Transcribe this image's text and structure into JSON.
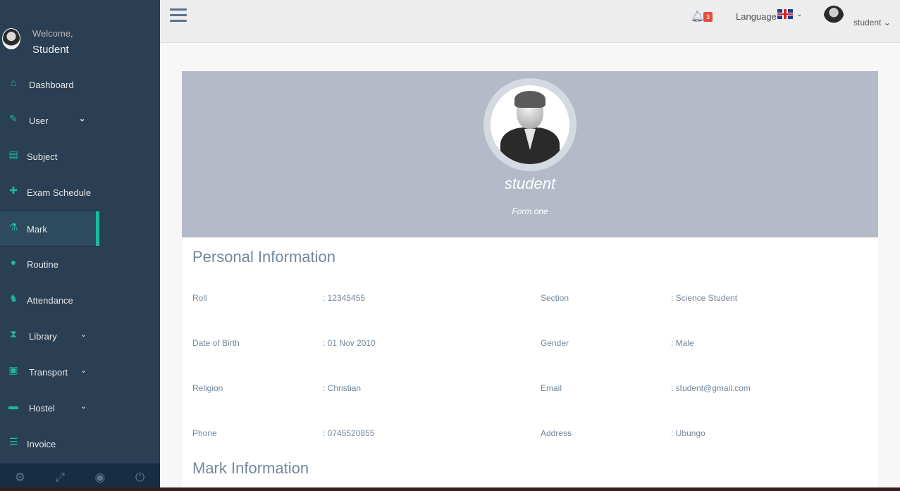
{
  "sidebar": {
    "welcome": "Welcome,",
    "username": "Student",
    "items": [
      {
        "label": "Dashboard",
        "icon": "home-icon",
        "glyph": "⌂",
        "chevron": ""
      },
      {
        "label": "User",
        "icon": "edit-icon",
        "glyph": "✎",
        "chevron": "⌄"
      },
      {
        "label": "Subject",
        "icon": "book-icon",
        "glyph": "▤",
        "chevron": ""
      },
      {
        "label": "Exam Schedule",
        "icon": "puzzle-icon",
        "glyph": "✚",
        "chevron": ""
      },
      {
        "label": "Mark",
        "icon": "flask-icon",
        "glyph": "⚗",
        "chevron": ""
      },
      {
        "label": "Routine",
        "icon": "check-circle-icon",
        "glyph": "●",
        "chevron": ""
      },
      {
        "label": "Attendance",
        "icon": "sitemap-icon",
        "glyph": "♞",
        "chevron": ""
      },
      {
        "label": "Library",
        "icon": "hourglass-icon",
        "glyph": "⧗",
        "chevron": "⌄"
      },
      {
        "label": "Transport",
        "icon": "bus-icon",
        "glyph": "▣",
        "chevron": "⌄"
      },
      {
        "label": "Hostel",
        "icon": "bed-icon",
        "glyph": "▬",
        "chevron": "⌄"
      },
      {
        "label": "Invoice",
        "icon": "list-icon",
        "glyph": "☰",
        "chevron": ""
      }
    ],
    "active": "Mark",
    "footer": [
      {
        "icon": "gear-icon",
        "glyph": "⚙"
      },
      {
        "icon": "fullscreen-icon",
        "glyph": "⤢"
      },
      {
        "icon": "eye-slash-icon",
        "glyph": "◉"
      },
      {
        "icon": "power-icon",
        "glyph": "⏻"
      }
    ]
  },
  "topnav": {
    "notification_count": "3",
    "language_label": "Language",
    "user_label": "student",
    "chevron": "⌄"
  },
  "profile": {
    "name": "student",
    "class": "Form one"
  },
  "personal": {
    "title": "Personal Information",
    "rows": [
      {
        "l1": "Roll",
        "v1": ": 12345455",
        "l2": "Section",
        "v2": ": Science Student"
      },
      {
        "l1": "Date of Birth",
        "v1": ": 01 Nov 2010",
        "l2": "Gender",
        "v2": ": Male"
      },
      {
        "l1": "Religion",
        "v1": ": Christian",
        "l2": "Email",
        "v2": ": student@gmail.com"
      },
      {
        "l1": "Phone",
        "v1": ": 0745520855",
        "l2": "Address",
        "v2": ": Ubungo"
      }
    ]
  },
  "mark": {
    "title": "Mark Information"
  },
  "colors": {
    "sidebar_bg": "#2a3f54",
    "accent": "#1abb9c",
    "cover_bg": "#b4bac8",
    "badge": "#e74c3c"
  }
}
